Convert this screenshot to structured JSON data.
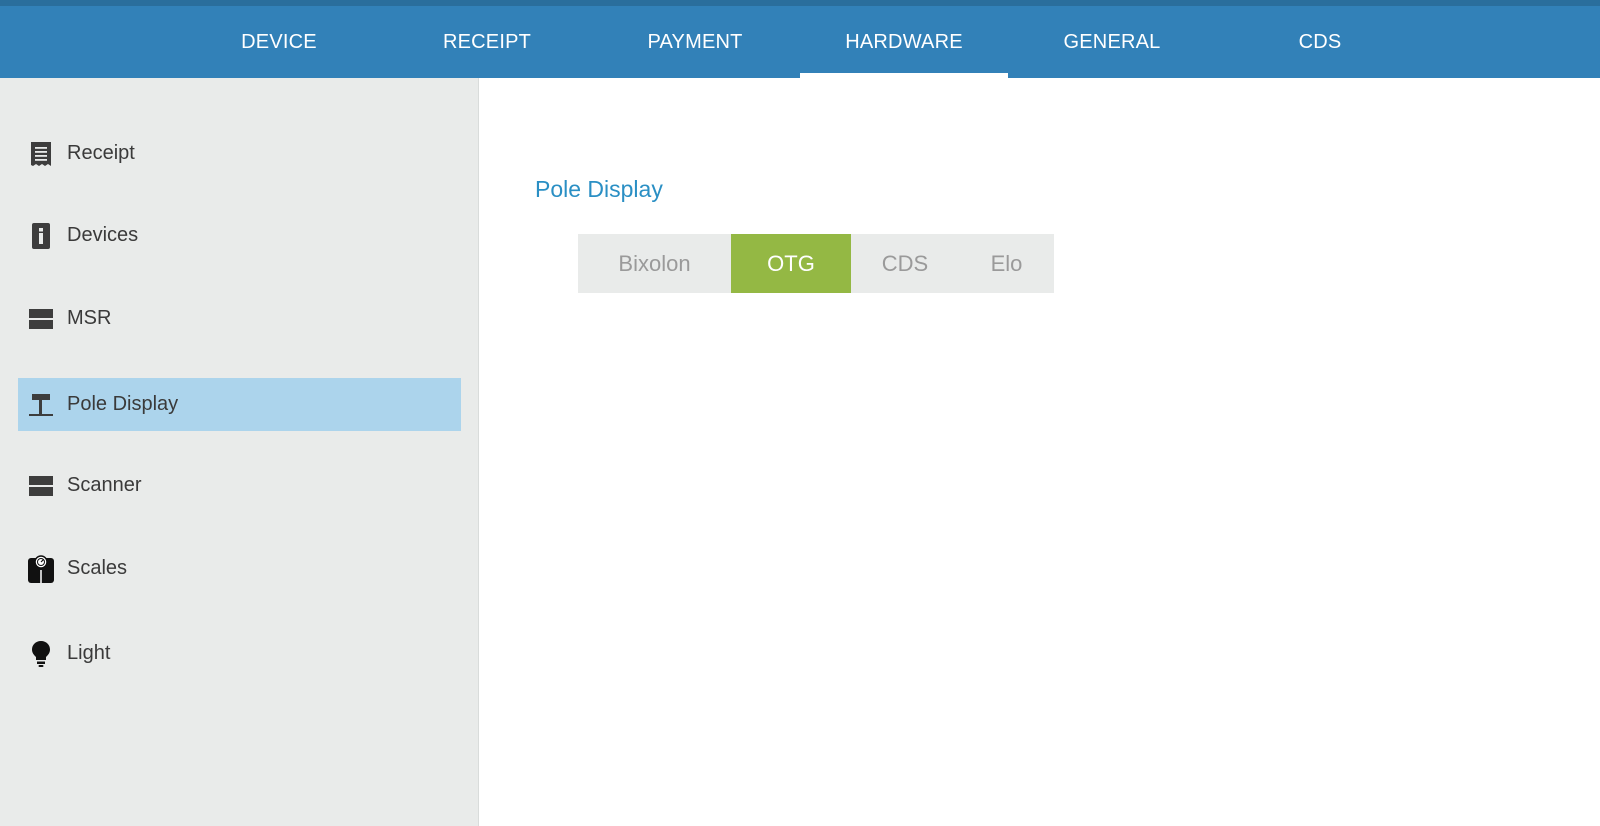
{
  "tabs": [
    {
      "label": "DEVICE"
    },
    {
      "label": "RECEIPT"
    },
    {
      "label": "PAYMENT"
    },
    {
      "label": "HARDWARE",
      "active": true
    },
    {
      "label": "GENERAL"
    },
    {
      "label": "CDS"
    }
  ],
  "sidebar": {
    "items": [
      {
        "label": "Receipt",
        "icon": "receipt-icon"
      },
      {
        "label": "Devices",
        "icon": "device-info-icon"
      },
      {
        "label": "MSR",
        "icon": "card-reader-icon"
      },
      {
        "label": "Pole Display",
        "icon": "pole-display-icon",
        "selected": true
      },
      {
        "label": "Scanner",
        "icon": "scanner-icon"
      },
      {
        "label": "Scales",
        "icon": "scale-icon"
      },
      {
        "label": "Light",
        "icon": "lightbulb-icon"
      }
    ]
  },
  "main": {
    "section_title": "Pole Display",
    "options": [
      {
        "label": "Bixolon"
      },
      {
        "label": "OTG",
        "selected": true
      },
      {
        "label": "CDS"
      },
      {
        "label": "Elo"
      }
    ]
  },
  "colors": {
    "header": "#3281b8",
    "selected_item": "#acd4ec",
    "accent_text": "#2a8fc4",
    "selected_option": "#94b844"
  }
}
